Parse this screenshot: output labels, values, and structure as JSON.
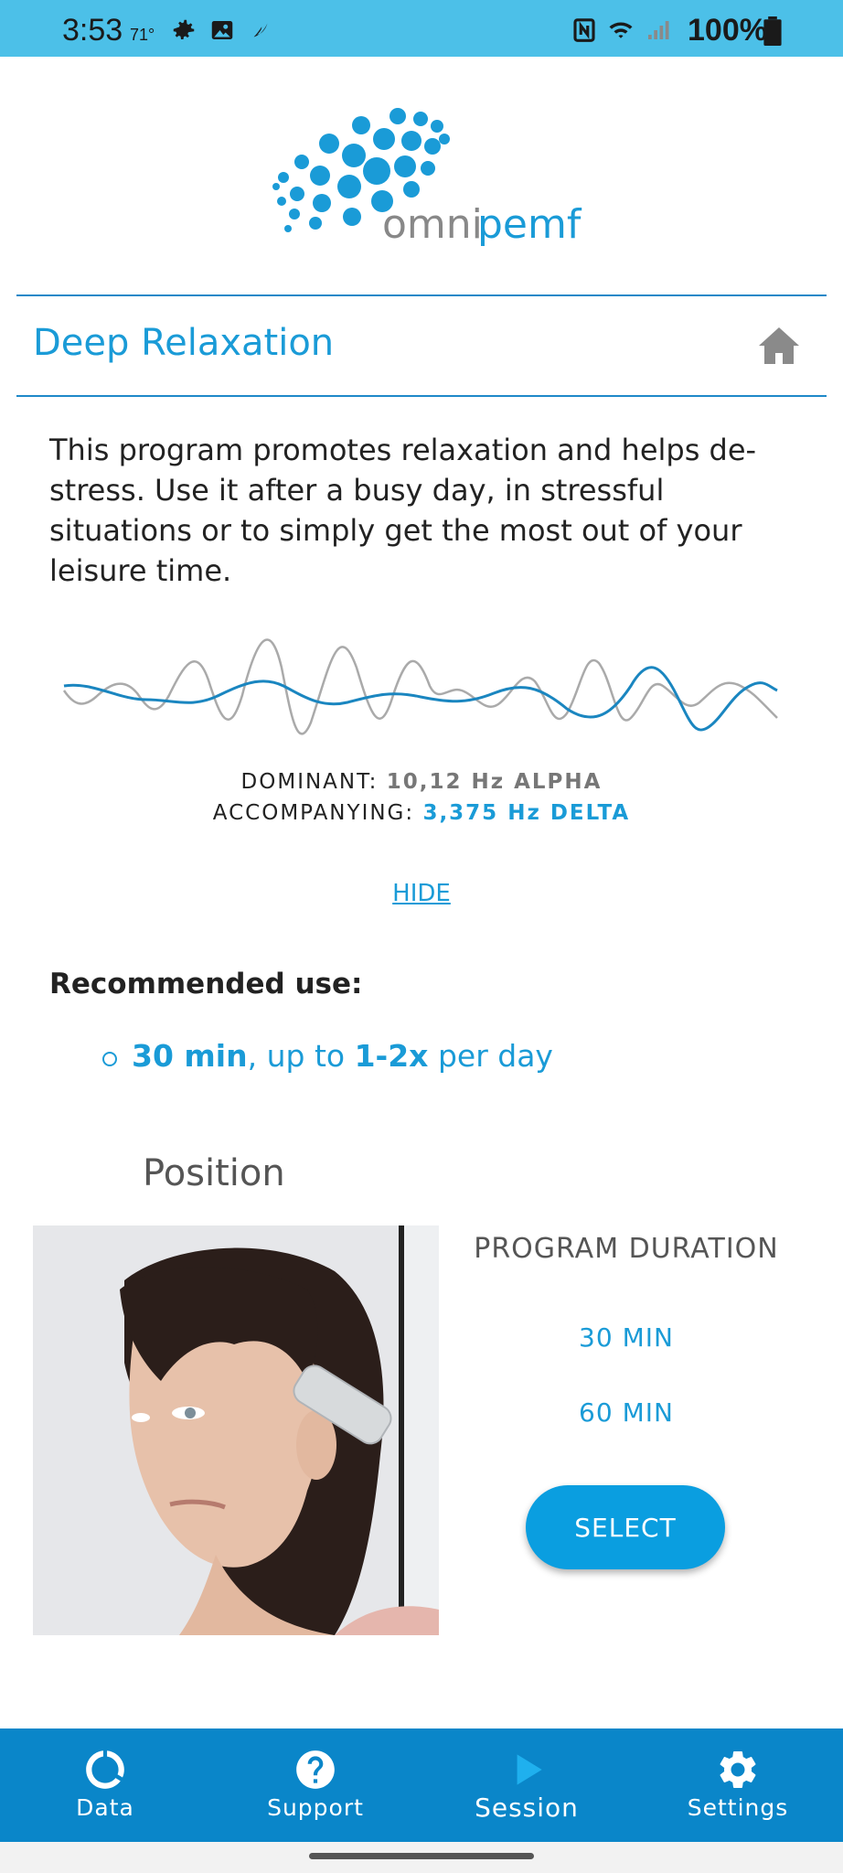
{
  "status_bar": {
    "time": "3:53",
    "temperature": "71°",
    "battery": "100%",
    "icons": [
      "settings-gear-icon",
      "image-icon",
      "swoosh-icon",
      "nfc-icon",
      "wifi-icon",
      "signal-icon",
      "battery-icon"
    ]
  },
  "app": {
    "brand": "omnipemf",
    "accent_color": "#1a9bd7"
  },
  "header": {
    "title": "Deep Relaxation",
    "home_icon": "home-icon"
  },
  "program": {
    "description": "This program promotes relaxation and helps de-stress. Use it after a busy day, in stressful situations or to simply get the most out of your leisure time.",
    "dominant_label": "DOMINANT:",
    "dominant_value": "10,12 Hz ALPHA",
    "accompanying_label": "ACCOMPANYING:",
    "accompanying_value": "3,375 Hz DELTA",
    "hide_link": "HIDE"
  },
  "recommended": {
    "title": "Recommended use:",
    "duration": "30 min",
    "middle": ", up to ",
    "frequency": "1-2x",
    "suffix": " per day"
  },
  "position": {
    "label": "Position"
  },
  "duration": {
    "label": "PROGRAM DURATION",
    "options": [
      "30 MIN",
      "60 MIN"
    ],
    "select_button": "SELECT"
  },
  "bottom_nav": {
    "items": [
      {
        "label": "Data",
        "icon": "circle-progress-icon"
      },
      {
        "label": "Support",
        "icon": "help-icon"
      },
      {
        "label": "Session",
        "icon": "play-icon",
        "active": true
      },
      {
        "label": "Settings",
        "icon": "gear-icon"
      }
    ]
  }
}
